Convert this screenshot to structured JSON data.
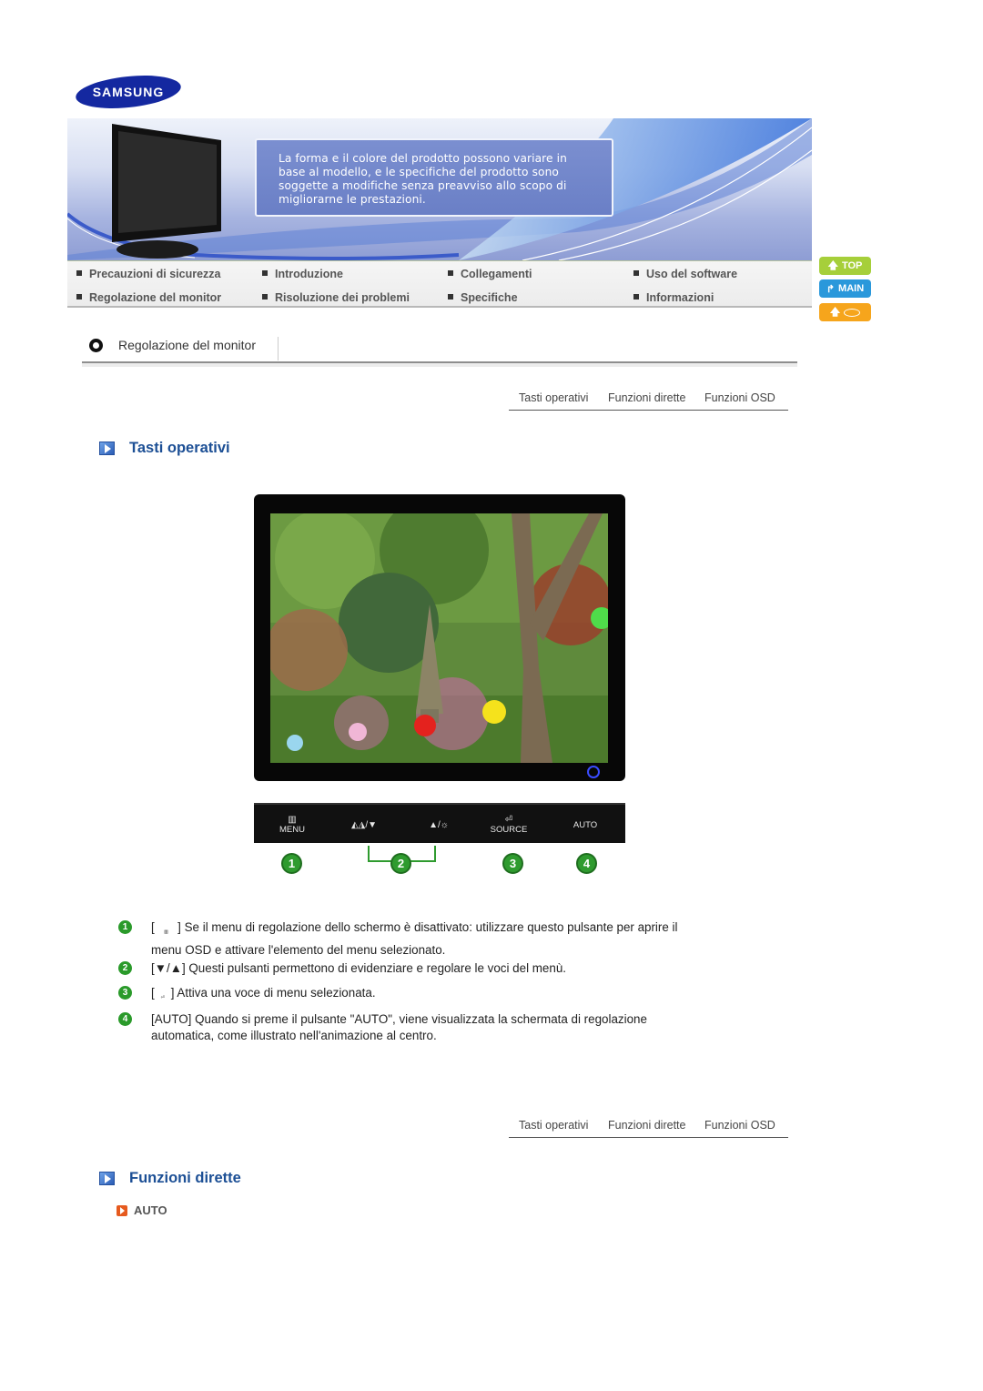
{
  "brand": {
    "logo_text": "SAMSUNG",
    "logo_color": "#1428a0"
  },
  "banner": {
    "note_lines": [
      "La forma e il colore del prodotto possono variare in",
      "base al modello, e le specifiche del prodotto sono",
      "soggette a modifiche senza preavviso allo scopo di",
      "migliorarne le prestazioni."
    ]
  },
  "nav": {
    "items": [
      {
        "label": "Precauzioni di sicurezza"
      },
      {
        "label": "Introduzione"
      },
      {
        "label": "Collegamenti"
      },
      {
        "label": "Uso del software"
      },
      {
        "label": "Regolazione del monitor"
      },
      {
        "label": "Risoluzione dei problemi"
      },
      {
        "label": "Specifiche"
      },
      {
        "label": "Informazioni"
      }
    ]
  },
  "side_buttons": {
    "top": {
      "label": "TOP",
      "icon": "arrow-up-icon",
      "color": "#a6cf3a"
    },
    "main": {
      "label": "MAIN",
      "icon": "arrow-turn-icon",
      "color": "#2a98db"
    },
    "print": {
      "label": "",
      "icon": "arrow-up-lips-icon",
      "color": "#f6a51c"
    }
  },
  "section": {
    "title": "Regolazione del monitor"
  },
  "subnav": {
    "items": [
      "Tasti operativi",
      "Funzioni dirette",
      "Funzioni OSD"
    ]
  },
  "headings": {
    "tasti": "Tasti operativi",
    "funzioni": "Funzioni dirette"
  },
  "button_bar": {
    "menu": {
      "glyph": "▥",
      "label": "MENU"
    },
    "down": {
      "glyph": "◭◮/▼",
      "label": ""
    },
    "up": {
      "glyph": "▲/☼",
      "label": ""
    },
    "source": {
      "glyph": "⏎",
      "label": "SOURCE"
    },
    "auto": {
      "glyph": "",
      "label": "AUTO"
    }
  },
  "numbers": [
    "1",
    "2",
    "3",
    "4"
  ],
  "descriptions": [
    {
      "num": "1",
      "prefix": "[ ",
      "icon": "MENU",
      "suffix": " ] Se il menu di regolazione dello schermo è disattivato: utilizzare questo pulsante per aprire il menu OSD e attivare l'elemento del menu selezionato."
    },
    {
      "num": "2",
      "prefix": "[▼/▲] ",
      "icon": "",
      "suffix": "Questi pulsanti permettono di evidenziare e regolare le voci del menù."
    },
    {
      "num": "3",
      "prefix": "[",
      "icon": "SOURCE",
      "suffix": "] Attiva una voce di menu selezionata."
    },
    {
      "num": "4",
      "prefix": "[AUTO] ",
      "icon": "",
      "suffix": "Quando si preme il pulsante \"AUTO\", viene visualizzata la schermata di regolazione automatica, come illustrato nell'animazione al centro."
    }
  ],
  "subsection": {
    "label": "AUTO"
  }
}
